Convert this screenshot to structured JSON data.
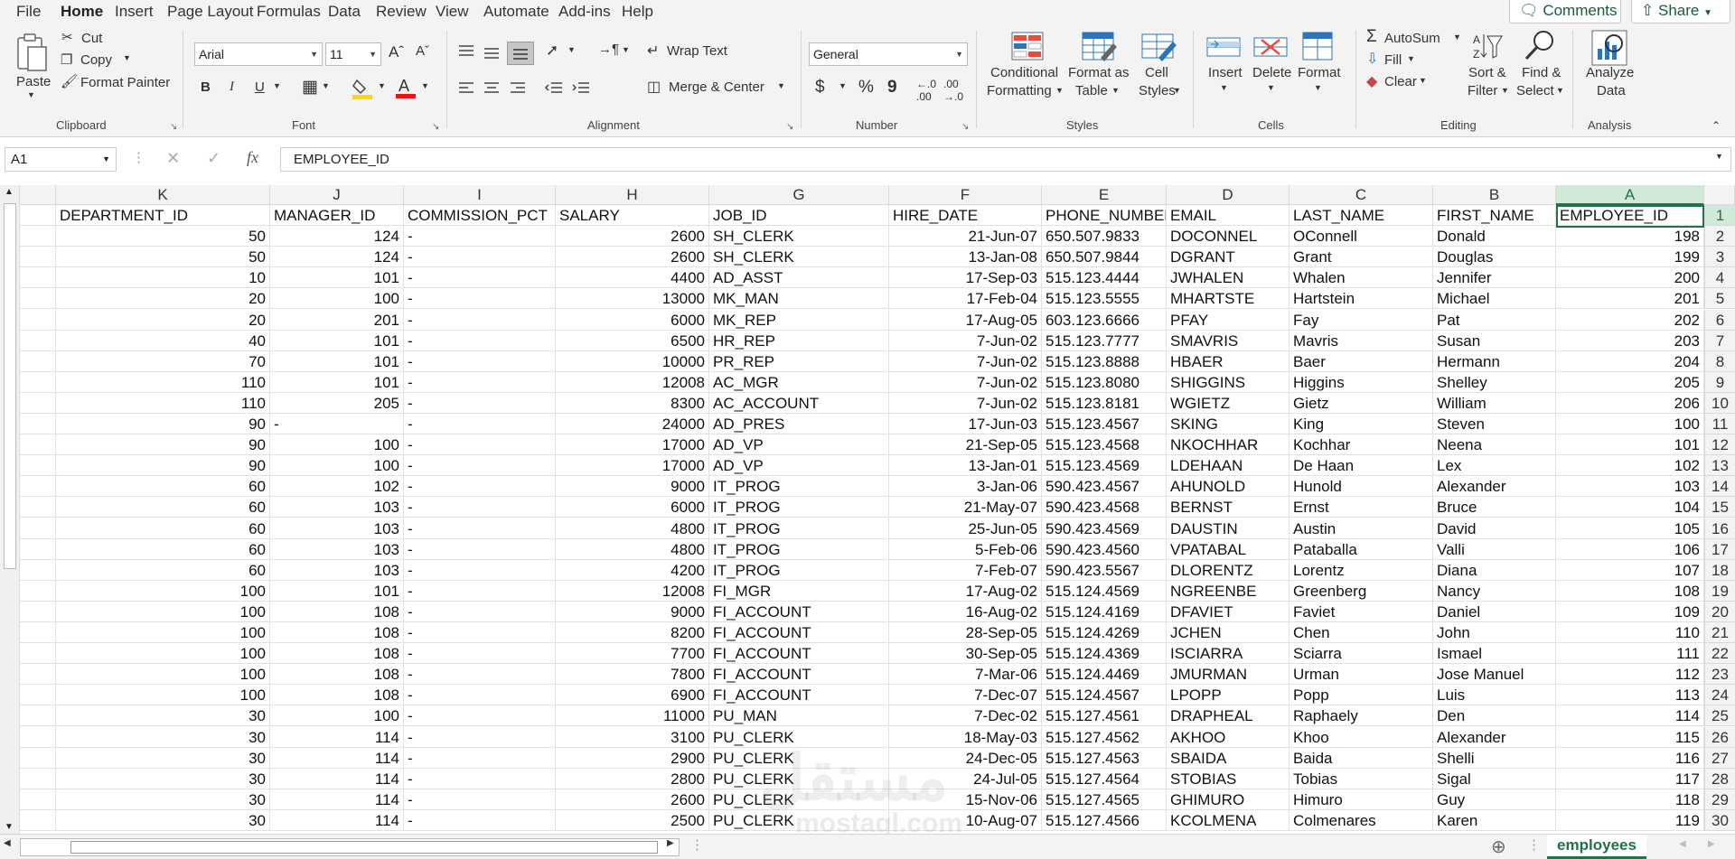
{
  "menu": {
    "items": [
      "File",
      "Home",
      "Insert",
      "Page Layout",
      "Formulas",
      "Data",
      "Review",
      "View",
      "Automate",
      "Add-ins",
      "Help"
    ],
    "active": "Home",
    "comments_label": "Comments",
    "share_label": "Share"
  },
  "ribbon": {
    "clipboard": {
      "paste": "Paste",
      "cut": "Cut",
      "copy": "Copy",
      "format_painter": "Format Painter",
      "label": "Clipboard"
    },
    "font": {
      "name": "Arial",
      "size": "11",
      "bold": "B",
      "italic": "I",
      "underline": "U",
      "label": "Font"
    },
    "alignment": {
      "wrap_text": "Wrap Text",
      "merge_center": "Merge & Center",
      "label": "Alignment"
    },
    "number": {
      "format": "General",
      "currency": "$",
      "percent": "%",
      "comma": "9",
      "label": "Number"
    },
    "styles": {
      "conditional_formatting": "Conditional",
      "conditional_formatting_2": "Formatting",
      "format_as_table": "Format as",
      "format_as_table_2": "Table",
      "cell_styles": "Cell",
      "cell_styles_2": "Styles",
      "label": "Styles"
    },
    "cells": {
      "insert": "Insert",
      "delete": "Delete",
      "format": "Format",
      "label": "Cells"
    },
    "editing": {
      "autosum": "AutoSum",
      "fill": "Fill",
      "clear": "Clear",
      "sort_filter": "Sort &",
      "sort_filter_2": "Filter",
      "find_select": "Find &",
      "find_select_2": "Select",
      "label": "Editing"
    },
    "analysis": {
      "analyze": "Analyze",
      "analyze_2": "Data",
      "label": "Analysis"
    }
  },
  "formula_bar": {
    "name_box": "A1",
    "fx": "fx",
    "content": "EMPLOYEE_ID"
  },
  "sheet": {
    "columns": [
      "K",
      "J",
      "I",
      "H",
      "G",
      "F",
      "E",
      "D",
      "C",
      "B",
      "A"
    ],
    "selected_column": "A",
    "selected_row": "1",
    "header_row": [
      "DEPARTMENT_ID",
      "MANAGER_ID",
      "COMMISSION_PCT",
      "SALARY",
      "JOB_ID",
      "HIRE_DATE",
      "PHONE_NUMBER",
      "EMAIL",
      "LAST_NAME",
      "FIRST_NAME",
      "EMPLOYEE_ID"
    ],
    "rows": [
      [
        "50",
        "124",
        "-",
        "2600",
        "SH_CLERK",
        "21-Jun-07",
        "650.507.9833",
        "DOCONNEL",
        "OConnell",
        "Donald",
        "198"
      ],
      [
        "50",
        "124",
        "-",
        "2600",
        "SH_CLERK",
        "13-Jan-08",
        "650.507.9844",
        "DGRANT",
        "Grant",
        "Douglas",
        "199"
      ],
      [
        "10",
        "101",
        "-",
        "4400",
        "AD_ASST",
        "17-Sep-03",
        "515.123.4444",
        "JWHALEN",
        "Whalen",
        "Jennifer",
        "200"
      ],
      [
        "20",
        "100",
        "-",
        "13000",
        "MK_MAN",
        "17-Feb-04",
        "515.123.5555",
        "MHARTSTE",
        "Hartstein",
        "Michael",
        "201"
      ],
      [
        "20",
        "201",
        "-",
        "6000",
        "MK_REP",
        "17-Aug-05",
        "603.123.6666",
        "PFAY",
        "Fay",
        "Pat",
        "202"
      ],
      [
        "40",
        "101",
        "-",
        "6500",
        "HR_REP",
        "7-Jun-02",
        "515.123.7777",
        "SMAVRIS",
        "Mavris",
        "Susan",
        "203"
      ],
      [
        "70",
        "101",
        "-",
        "10000",
        "PR_REP",
        "7-Jun-02",
        "515.123.8888",
        "HBAER",
        "Baer",
        "Hermann",
        "204"
      ],
      [
        "110",
        "101",
        "-",
        "12008",
        "AC_MGR",
        "7-Jun-02",
        "515.123.8080",
        "SHIGGINS",
        "Higgins",
        "Shelley",
        "205"
      ],
      [
        "110",
        "205",
        "-",
        "8300",
        "AC_ACCOUNT",
        "7-Jun-02",
        "515.123.8181",
        "WGIETZ",
        "Gietz",
        "William",
        "206"
      ],
      [
        "90",
        "-",
        "-",
        "24000",
        "AD_PRES",
        "17-Jun-03",
        "515.123.4567",
        "SKING",
        "King",
        "Steven",
        "100"
      ],
      [
        "90",
        "100",
        "-",
        "17000",
        "AD_VP",
        "21-Sep-05",
        "515.123.4568",
        "NKOCHHAR",
        "Kochhar",
        "Neena",
        "101"
      ],
      [
        "90",
        "100",
        "-",
        "17000",
        "AD_VP",
        "13-Jan-01",
        "515.123.4569",
        "LDEHAAN",
        "De Haan",
        "Lex",
        "102"
      ],
      [
        "60",
        "102",
        "-",
        "9000",
        "IT_PROG",
        "3-Jan-06",
        "590.423.4567",
        "AHUNOLD",
        "Hunold",
        "Alexander",
        "103"
      ],
      [
        "60",
        "103",
        "-",
        "6000",
        "IT_PROG",
        "21-May-07",
        "590.423.4568",
        "BERNST",
        "Ernst",
        "Bruce",
        "104"
      ],
      [
        "60",
        "103",
        "-",
        "4800",
        "IT_PROG",
        "25-Jun-05",
        "590.423.4569",
        "DAUSTIN",
        "Austin",
        "David",
        "105"
      ],
      [
        "60",
        "103",
        "-",
        "4800",
        "IT_PROG",
        "5-Feb-06",
        "590.423.4560",
        "VPATABAL",
        "Pataballa",
        "Valli",
        "106"
      ],
      [
        "60",
        "103",
        "-",
        "4200",
        "IT_PROG",
        "7-Feb-07",
        "590.423.5567",
        "DLORENTZ",
        "Lorentz",
        "Diana",
        "107"
      ],
      [
        "100",
        "101",
        "-",
        "12008",
        "FI_MGR",
        "17-Aug-02",
        "515.124.4569",
        "NGREENBE",
        "Greenberg",
        "Nancy",
        "108"
      ],
      [
        "100",
        "108",
        "-",
        "9000",
        "FI_ACCOUNT",
        "16-Aug-02",
        "515.124.4169",
        "DFAVIET",
        "Faviet",
        "Daniel",
        "109"
      ],
      [
        "100",
        "108",
        "-",
        "8200",
        "FI_ACCOUNT",
        "28-Sep-05",
        "515.124.4269",
        "JCHEN",
        "Chen",
        "John",
        "110"
      ],
      [
        "100",
        "108",
        "-",
        "7700",
        "FI_ACCOUNT",
        "30-Sep-05",
        "515.124.4369",
        "ISCIARRA",
        "Sciarra",
        "Ismael",
        "111"
      ],
      [
        "100",
        "108",
        "-",
        "7800",
        "FI_ACCOUNT",
        "7-Mar-06",
        "515.124.4469",
        "JMURMAN",
        "Urman",
        "Jose Manuel",
        "112"
      ],
      [
        "100",
        "108",
        "-",
        "6900",
        "FI_ACCOUNT",
        "7-Dec-07",
        "515.124.4567",
        "LPOPP",
        "Popp",
        "Luis",
        "113"
      ],
      [
        "30",
        "100",
        "-",
        "11000",
        "PU_MAN",
        "7-Dec-02",
        "515.127.4561",
        "DRAPHEAL",
        "Raphaely",
        "Den",
        "114"
      ],
      [
        "30",
        "114",
        "-",
        "3100",
        "PU_CLERK",
        "18-May-03",
        "515.127.4562",
        "AKHOO",
        "Khoo",
        "Alexander",
        "115"
      ],
      [
        "30",
        "114",
        "-",
        "2900",
        "PU_CLERK",
        "24-Dec-05",
        "515.127.4563",
        "SBAIDA",
        "Baida",
        "Shelli",
        "116"
      ],
      [
        "30",
        "114",
        "-",
        "2800",
        "PU_CLERK",
        "24-Jul-05",
        "515.127.4564",
        "STOBIAS",
        "Tobias",
        "Sigal",
        "117"
      ],
      [
        "30",
        "114",
        "-",
        "2600",
        "PU_CLERK",
        "15-Nov-06",
        "515.127.4565",
        "GHIMURO",
        "Himuro",
        "Guy",
        "118"
      ],
      [
        "30",
        "114",
        "-",
        "2500",
        "PU_CLERK",
        "10-Aug-07",
        "515.127.4566",
        "KCOLMENA",
        "Colmenares",
        "Karen",
        "119"
      ]
    ],
    "sheet_tab": "employees"
  },
  "watermark": {
    "text": "مستقل",
    "sub": "mostaql.com"
  },
  "colors": {
    "accent": "#217346",
    "ribbon_bg": "#f3f3f3"
  }
}
